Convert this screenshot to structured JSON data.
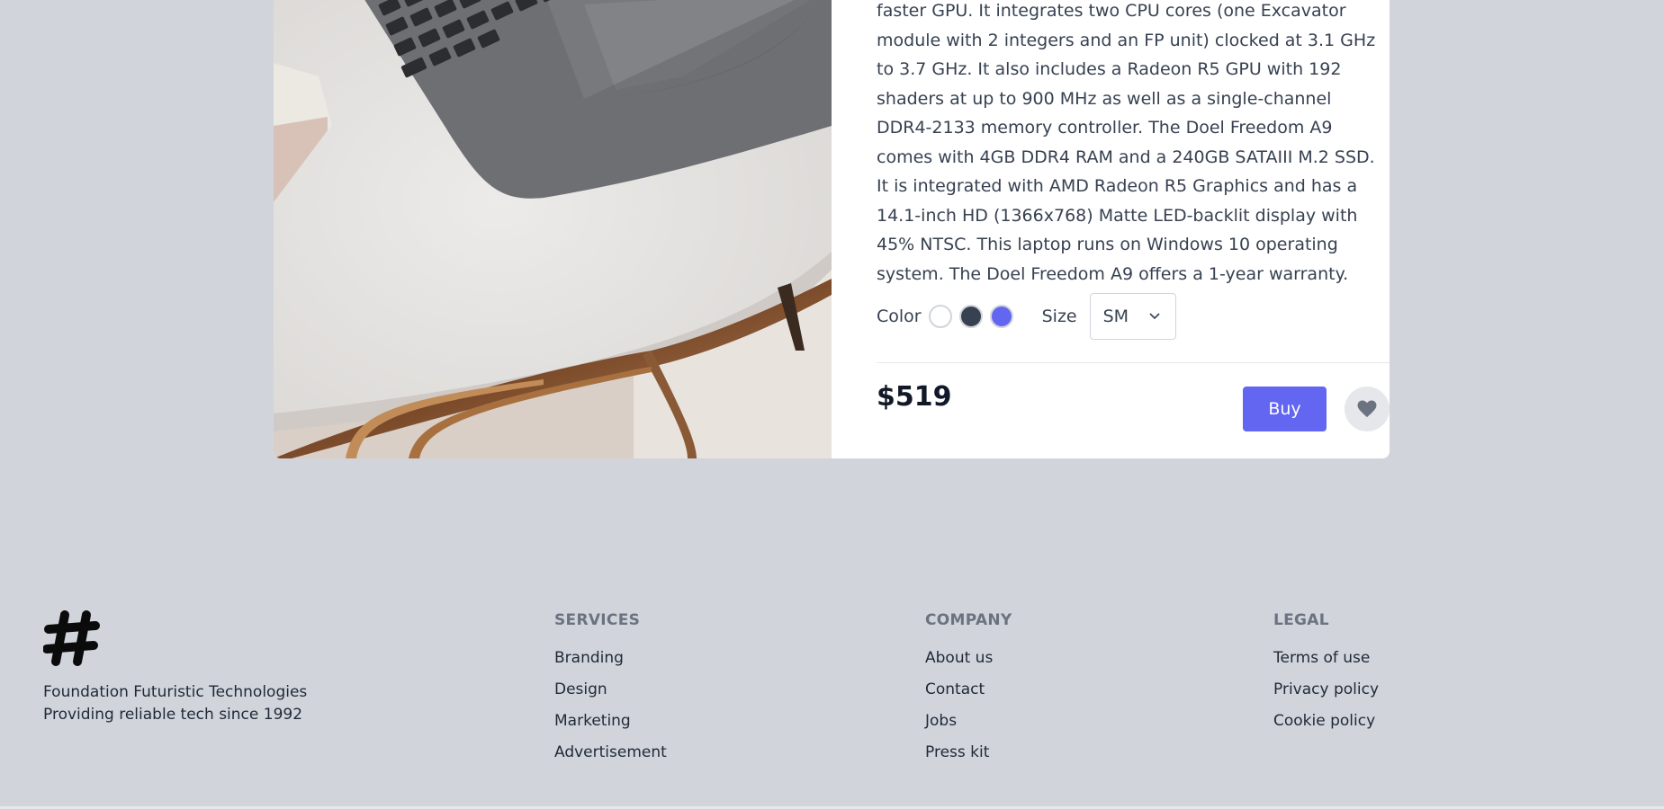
{
  "product": {
    "description": "faster GPU. It integrates two CPU cores (one Excavator module with 2 integers and an FP unit) clocked at 3.1 GHz to 3.7 GHz. It also includes a Radeon R5 GPU with 192 shaders at up to 900 MHz as well as a single-channel DDR4-2133 memory controller. The Doel Freedom A9 comes with 4GB DDR4 RAM and a 240GB SATAIII M.2 SSD. It is integrated with AMD Radeon R5 Graphics and has a 14.1-inch HD (1366x768) Matte LED-backlit display with 45% NTSC. This laptop runs on Windows 10 operating system. The Doel Freedom A9 offers a 1-year warranty.",
    "color_label": "Color",
    "colors": [
      "#ffffff",
      "#374151",
      "#6366f1"
    ],
    "size_label": "Size",
    "size_value": "SM",
    "price": "$519",
    "buy_label": "Buy",
    "accent": "#6366f1"
  },
  "footer": {
    "brand_line1": "Foundation Futuristic Technologies",
    "brand_line2": "Providing reliable tech since 1992",
    "services": {
      "title": "SERVICES",
      "links": [
        "Branding",
        "Design",
        "Marketing",
        "Advertisement"
      ]
    },
    "company": {
      "title": "COMPANY",
      "links": [
        "About us",
        "Contact",
        "Jobs",
        "Press kit"
      ]
    },
    "legal": {
      "title": "LEGAL",
      "links": [
        "Terms of use",
        "Privacy policy",
        "Cookie policy"
      ]
    }
  }
}
